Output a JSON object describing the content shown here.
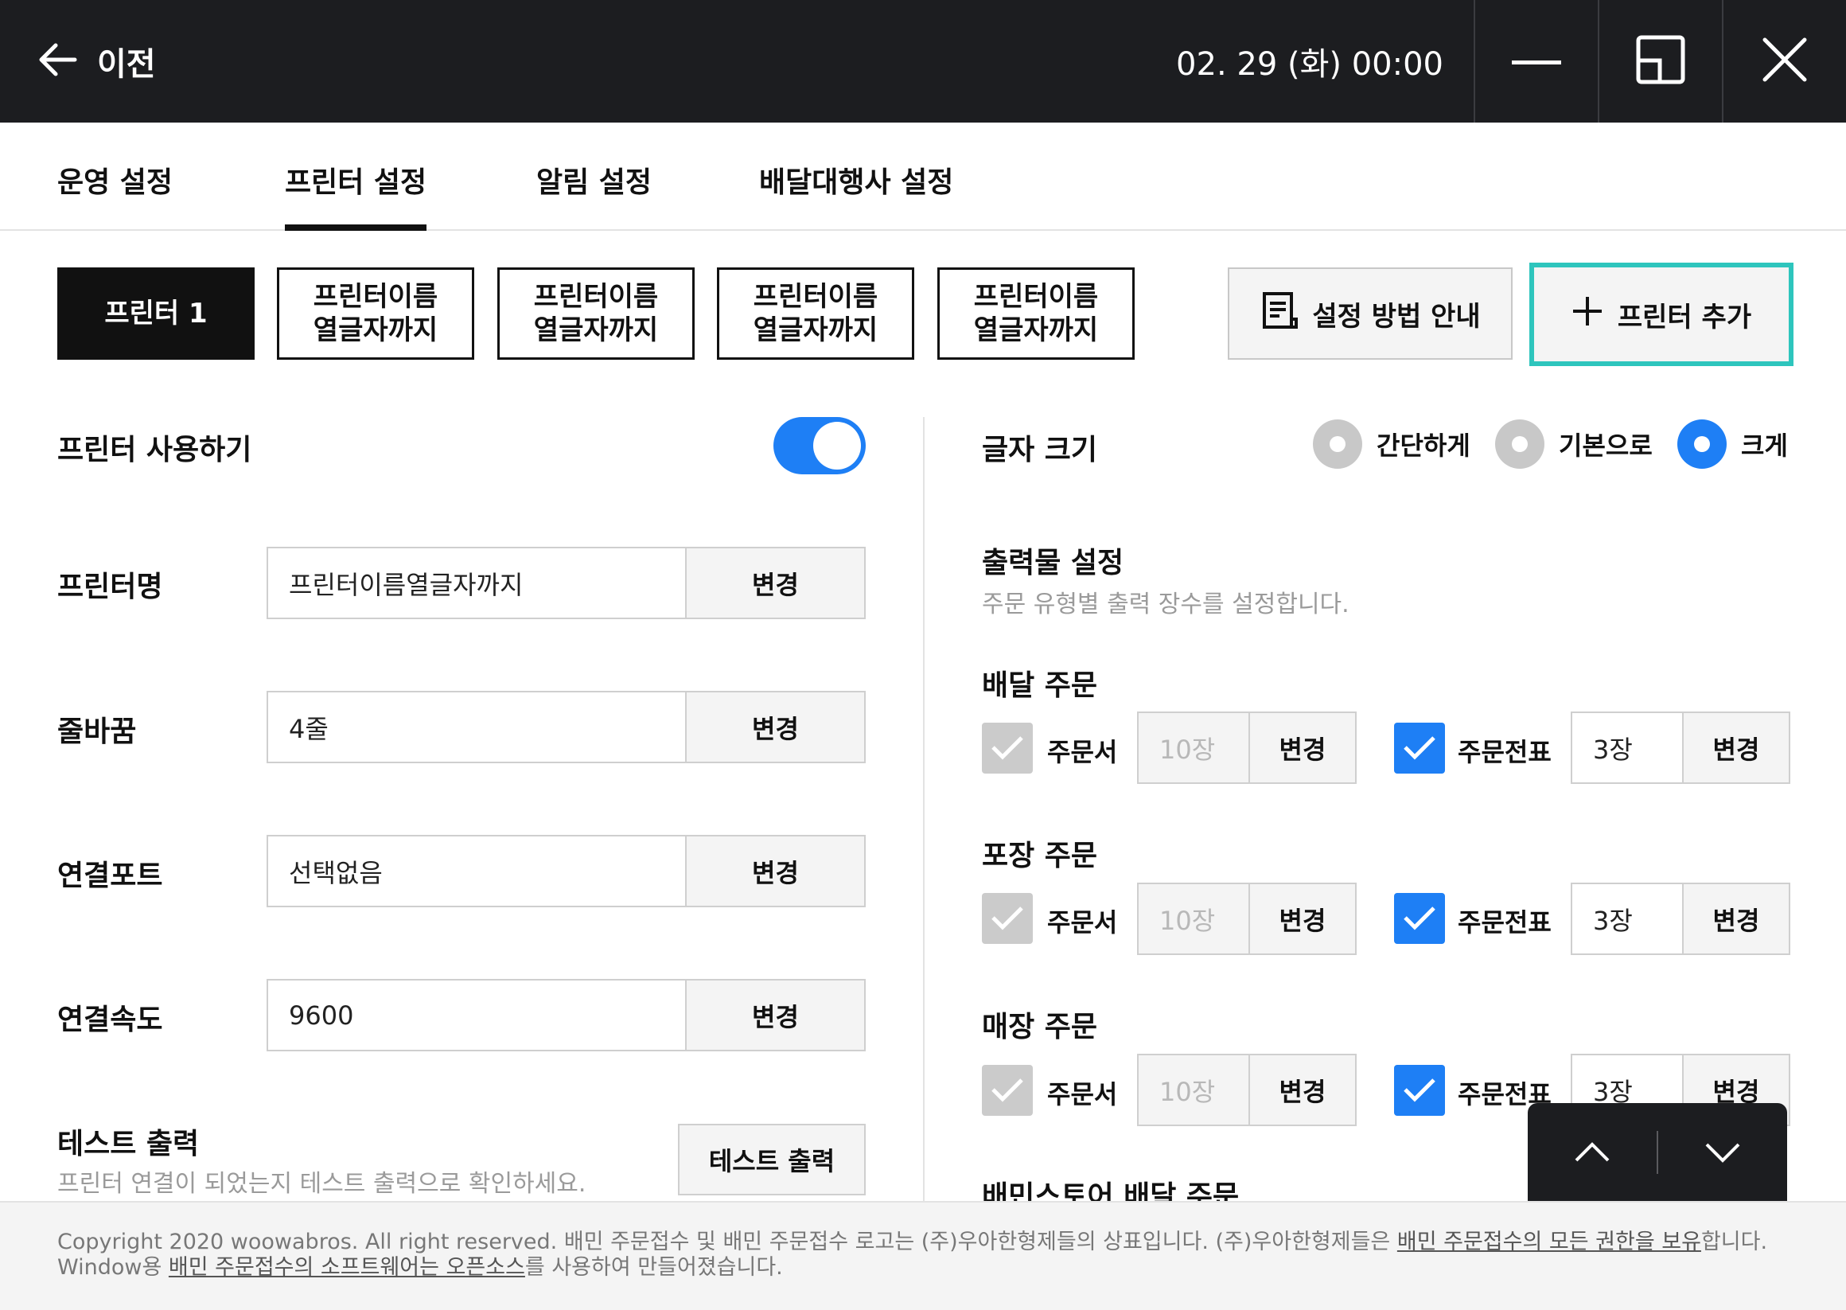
{
  "topbar": {
    "back_label": "이전",
    "datetime": "02. 29 (화) 00:00"
  },
  "tabs": [
    {
      "label": "운영 설정"
    },
    {
      "label": "프린터 설정"
    },
    {
      "label": "알림 설정"
    },
    {
      "label": "배달대행사 설정"
    }
  ],
  "printer_tabs": [
    {
      "label": "프린터 1"
    },
    {
      "label": "프린터이름\n열글자까지"
    },
    {
      "label": "프린터이름\n열글자까지"
    },
    {
      "label": "프린터이름\n열글자까지"
    },
    {
      "label": "프린터이름\n열글자까지"
    }
  ],
  "actions": {
    "guide_label": "설정 방법 안내",
    "add_label": "프린터 추가"
  },
  "left": {
    "use_label": "프린터 사용하기",
    "use_enabled": true,
    "fields": [
      {
        "label": "프린터명",
        "value": "프린터이름열글자까지",
        "button": "변경"
      },
      {
        "label": "줄바꿈",
        "value": "4줄",
        "button": "변경"
      },
      {
        "label": "연결포트",
        "value": "선택없음",
        "button": "변경"
      },
      {
        "label": "연결속도",
        "value": "9600",
        "button": "변경"
      }
    ],
    "test": {
      "title": "테스트 출력",
      "desc": "프린터 연결이 되었는지 테스트 출력으로 확인하세요.",
      "button": "테스트 출력"
    }
  },
  "right": {
    "font_size_label": "글자 크기",
    "font_options": [
      {
        "label": "간단하게",
        "selected": false
      },
      {
        "label": "기본으로",
        "selected": false
      },
      {
        "label": "크게",
        "selected": true
      }
    ],
    "output_title": "출력물 설정",
    "output_desc": "주문 유형별 출력 장수를 설정합니다.",
    "sections": [
      {
        "title": "배달 주문",
        "doc": {
          "label": "주문서",
          "checked": false,
          "count": "10장",
          "button": "변경"
        },
        "slip": {
          "label": "주문전표",
          "checked": true,
          "count": "3장",
          "button": "변경"
        }
      },
      {
        "title": "포장 주문",
        "doc": {
          "label": "주문서",
          "checked": false,
          "count": "10장",
          "button": "변경"
        },
        "slip": {
          "label": "주문전표",
          "checked": true,
          "count": "3장",
          "button": "변경"
        }
      },
      {
        "title": "매장 주문",
        "doc": {
          "label": "주문서",
          "checked": false,
          "count": "10장",
          "button": "변경"
        },
        "slip": {
          "label": "주문전표",
          "checked": true,
          "count": "3장",
          "button": "변경"
        }
      }
    ],
    "next_section_title": "배민스토어 배달 주문"
  },
  "footer": {
    "line1_a": "Copyright 2020 woowabros. All right reserved. 배민 주문접수 및 배민 주문접수 로고는 (주)우아한형제들의 상표입니다. (주)우아한형제들은 ",
    "line1_link": "배민 주문접수의 모든 권한을 보유",
    "line1_b": "합니다.",
    "line2_a": "Window용 ",
    "line2_link": "배민 주문접수의 소프트웨어는 오픈소스",
    "line2_b": "를 사용하여 만들어졌습니다."
  },
  "colors": {
    "accent": "#1e7ff5",
    "highlight": "#2ec5bd",
    "dark": "#1c1d20"
  }
}
